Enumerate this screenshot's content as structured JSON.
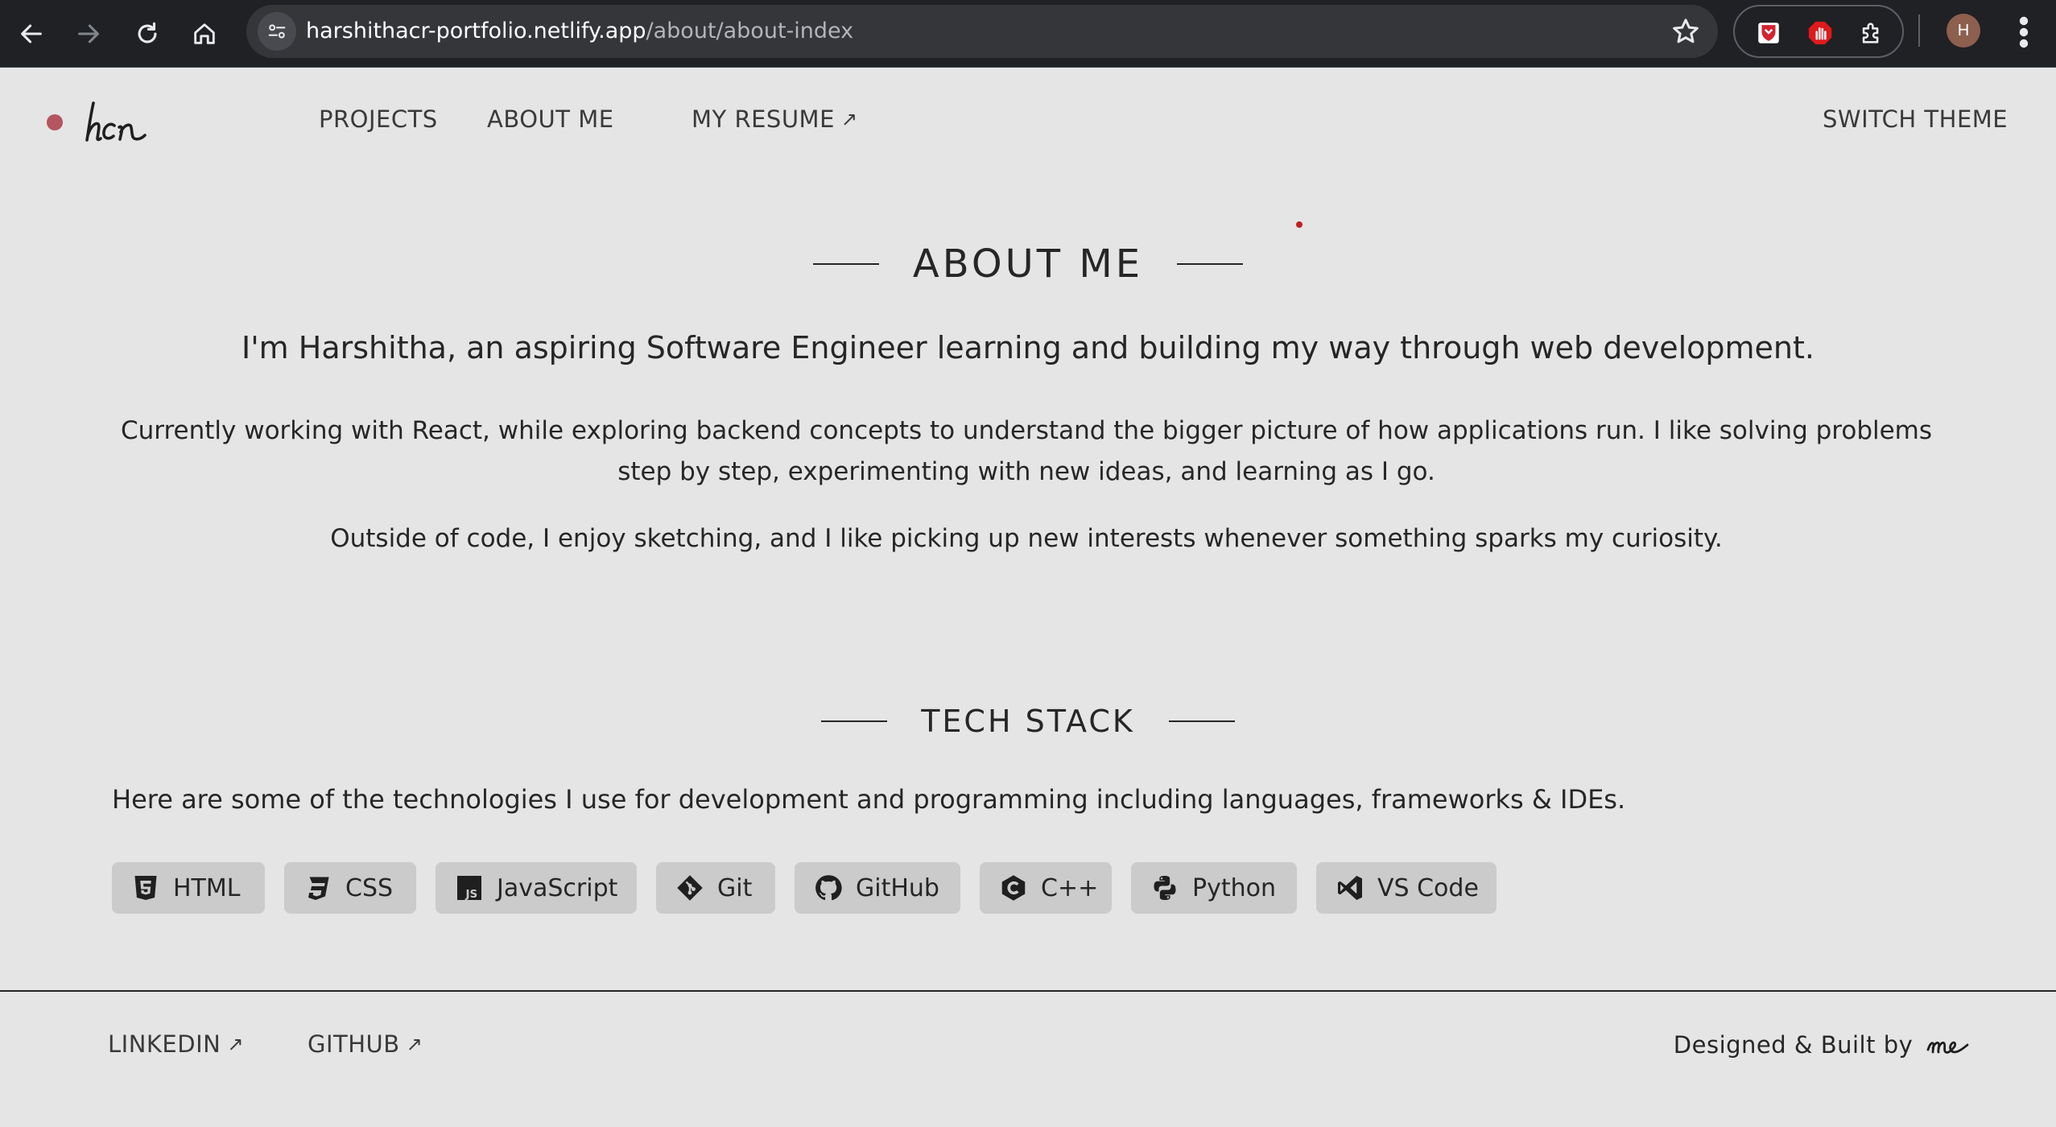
{
  "browser": {
    "url_host": "harshithacr-portfolio.netlify.app",
    "url_path": "/about/about-index",
    "profile_initial": "H",
    "icons": [
      "back-icon",
      "forward-icon",
      "reload-icon",
      "home-icon",
      "site-info-icon",
      "bookmark-star-icon",
      "extension-shield-icon",
      "extension-hand-icon",
      "extensions-puzzle-icon",
      "more-menu-icon"
    ]
  },
  "nav": {
    "logo": "hcr",
    "projects": "PROJECTS",
    "about": "ABOUT ME",
    "resume": "MY RESUME",
    "resume_arrow": "↗",
    "switch_theme": "SWITCH THEME",
    "accent_color": "#b4555f"
  },
  "about": {
    "title": "ABOUT ME",
    "intro": "I'm Harshitha, an aspiring Software Engineer learning and building my way through web development.",
    "paragraph1": "Currently working with React, while exploring backend concepts to understand the bigger picture of how applications run. I like solving problems step by step, experimenting with new ideas, and learning as I go.",
    "paragraph2": "Outside of code, I enjoy sketching, and I like picking up new interests whenever something sparks my curiosity."
  },
  "tech": {
    "title": "TECH STACK",
    "description": "Here are some of the technologies I use for development and programming including languages, frameworks & IDEs.",
    "chips": [
      {
        "label": "HTML",
        "icon": "html5-icon"
      },
      {
        "label": "CSS",
        "icon": "css3-icon"
      },
      {
        "label": "JavaScript",
        "icon": "javascript-icon"
      },
      {
        "label": "Git",
        "icon": "git-icon"
      },
      {
        "label": "GitHub",
        "icon": "github-icon"
      },
      {
        "label": "C++",
        "icon": "cplusplus-icon"
      },
      {
        "label": "Python",
        "icon": "python-icon"
      },
      {
        "label": "VS Code",
        "icon": "vscode-icon"
      }
    ]
  },
  "footer": {
    "linkedin": "LINKEDIN",
    "github": "GITHUB",
    "arrow": "↗",
    "credit": "Designed & Built by",
    "signature": "me"
  }
}
